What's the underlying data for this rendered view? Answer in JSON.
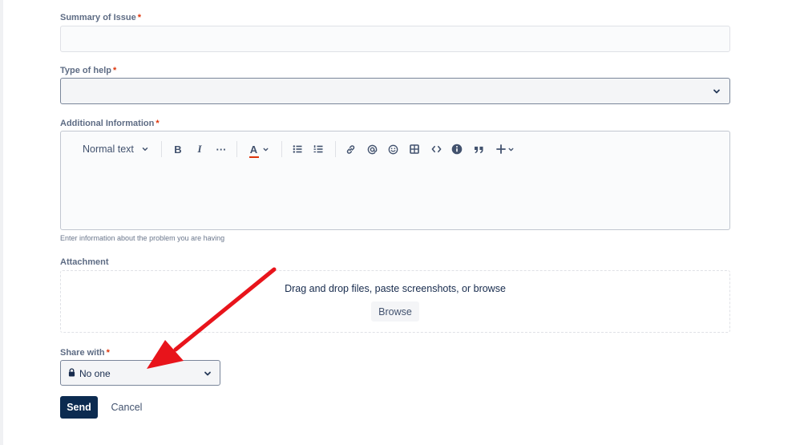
{
  "form": {
    "summary": {
      "label": "Summary of Issue",
      "required_mark": "*",
      "value": ""
    },
    "type_of_help": {
      "label": "Type of help",
      "required_mark": "*",
      "value": ""
    },
    "additional_info": {
      "label": "Additional Information",
      "required_mark": "*",
      "value": "",
      "helper_text": "Enter information about the problem you are having",
      "toolbar": {
        "text_style": "Normal text",
        "bold": "B",
        "italic": "I",
        "more": "···",
        "text_color": "A"
      }
    },
    "attachment": {
      "label": "Attachment",
      "dropzone_text": "Drag and drop files, paste screenshots, or browse",
      "browse_label": "Browse"
    },
    "share_with": {
      "label": "Share with",
      "required_mark": "*",
      "value": "No one"
    },
    "actions": {
      "send_label": "Send",
      "cancel_label": "Cancel"
    }
  },
  "icons": {
    "toolbar": [
      "chevron-down-icon",
      "bold-icon",
      "italic-icon",
      "more-icon",
      "text-color-icon",
      "bullet-list-icon",
      "numbered-list-icon",
      "link-icon",
      "mention-icon",
      "emoji-icon",
      "table-icon",
      "code-icon",
      "info-icon",
      "quote-icon",
      "insert-plus-icon"
    ],
    "share": "lock-icon"
  },
  "colors": {
    "primary_button": "#0c2b50",
    "required_marker": "#de350b",
    "annotation_arrow": "#e8141b",
    "text_color_underline": "#de350b"
  }
}
